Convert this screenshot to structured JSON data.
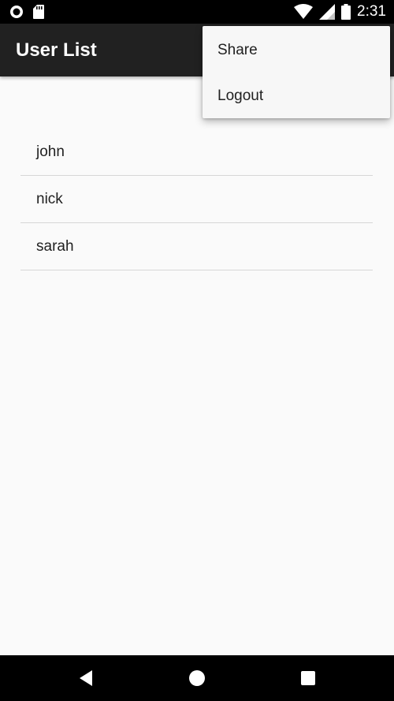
{
  "status_bar": {
    "time": "2:31",
    "icons": [
      "record-icon",
      "sd-card-icon",
      "wifi-icon",
      "cell-signal-icon",
      "battery-icon"
    ]
  },
  "app_bar": {
    "title": "User List"
  },
  "users": [
    {
      "label": "john"
    },
    {
      "label": "nick"
    },
    {
      "label": "sarah"
    }
  ],
  "overflow_menu": {
    "items": [
      {
        "label": "Share"
      },
      {
        "label": "Logout"
      }
    ]
  },
  "nav_bar": {
    "icons": [
      "back-icon",
      "home-icon",
      "recents-icon"
    ]
  },
  "colors": {
    "app_bar": "#212121",
    "background": "#fafafa",
    "menu_background": "#f7f7f7",
    "divider": "#d6d6d6"
  }
}
